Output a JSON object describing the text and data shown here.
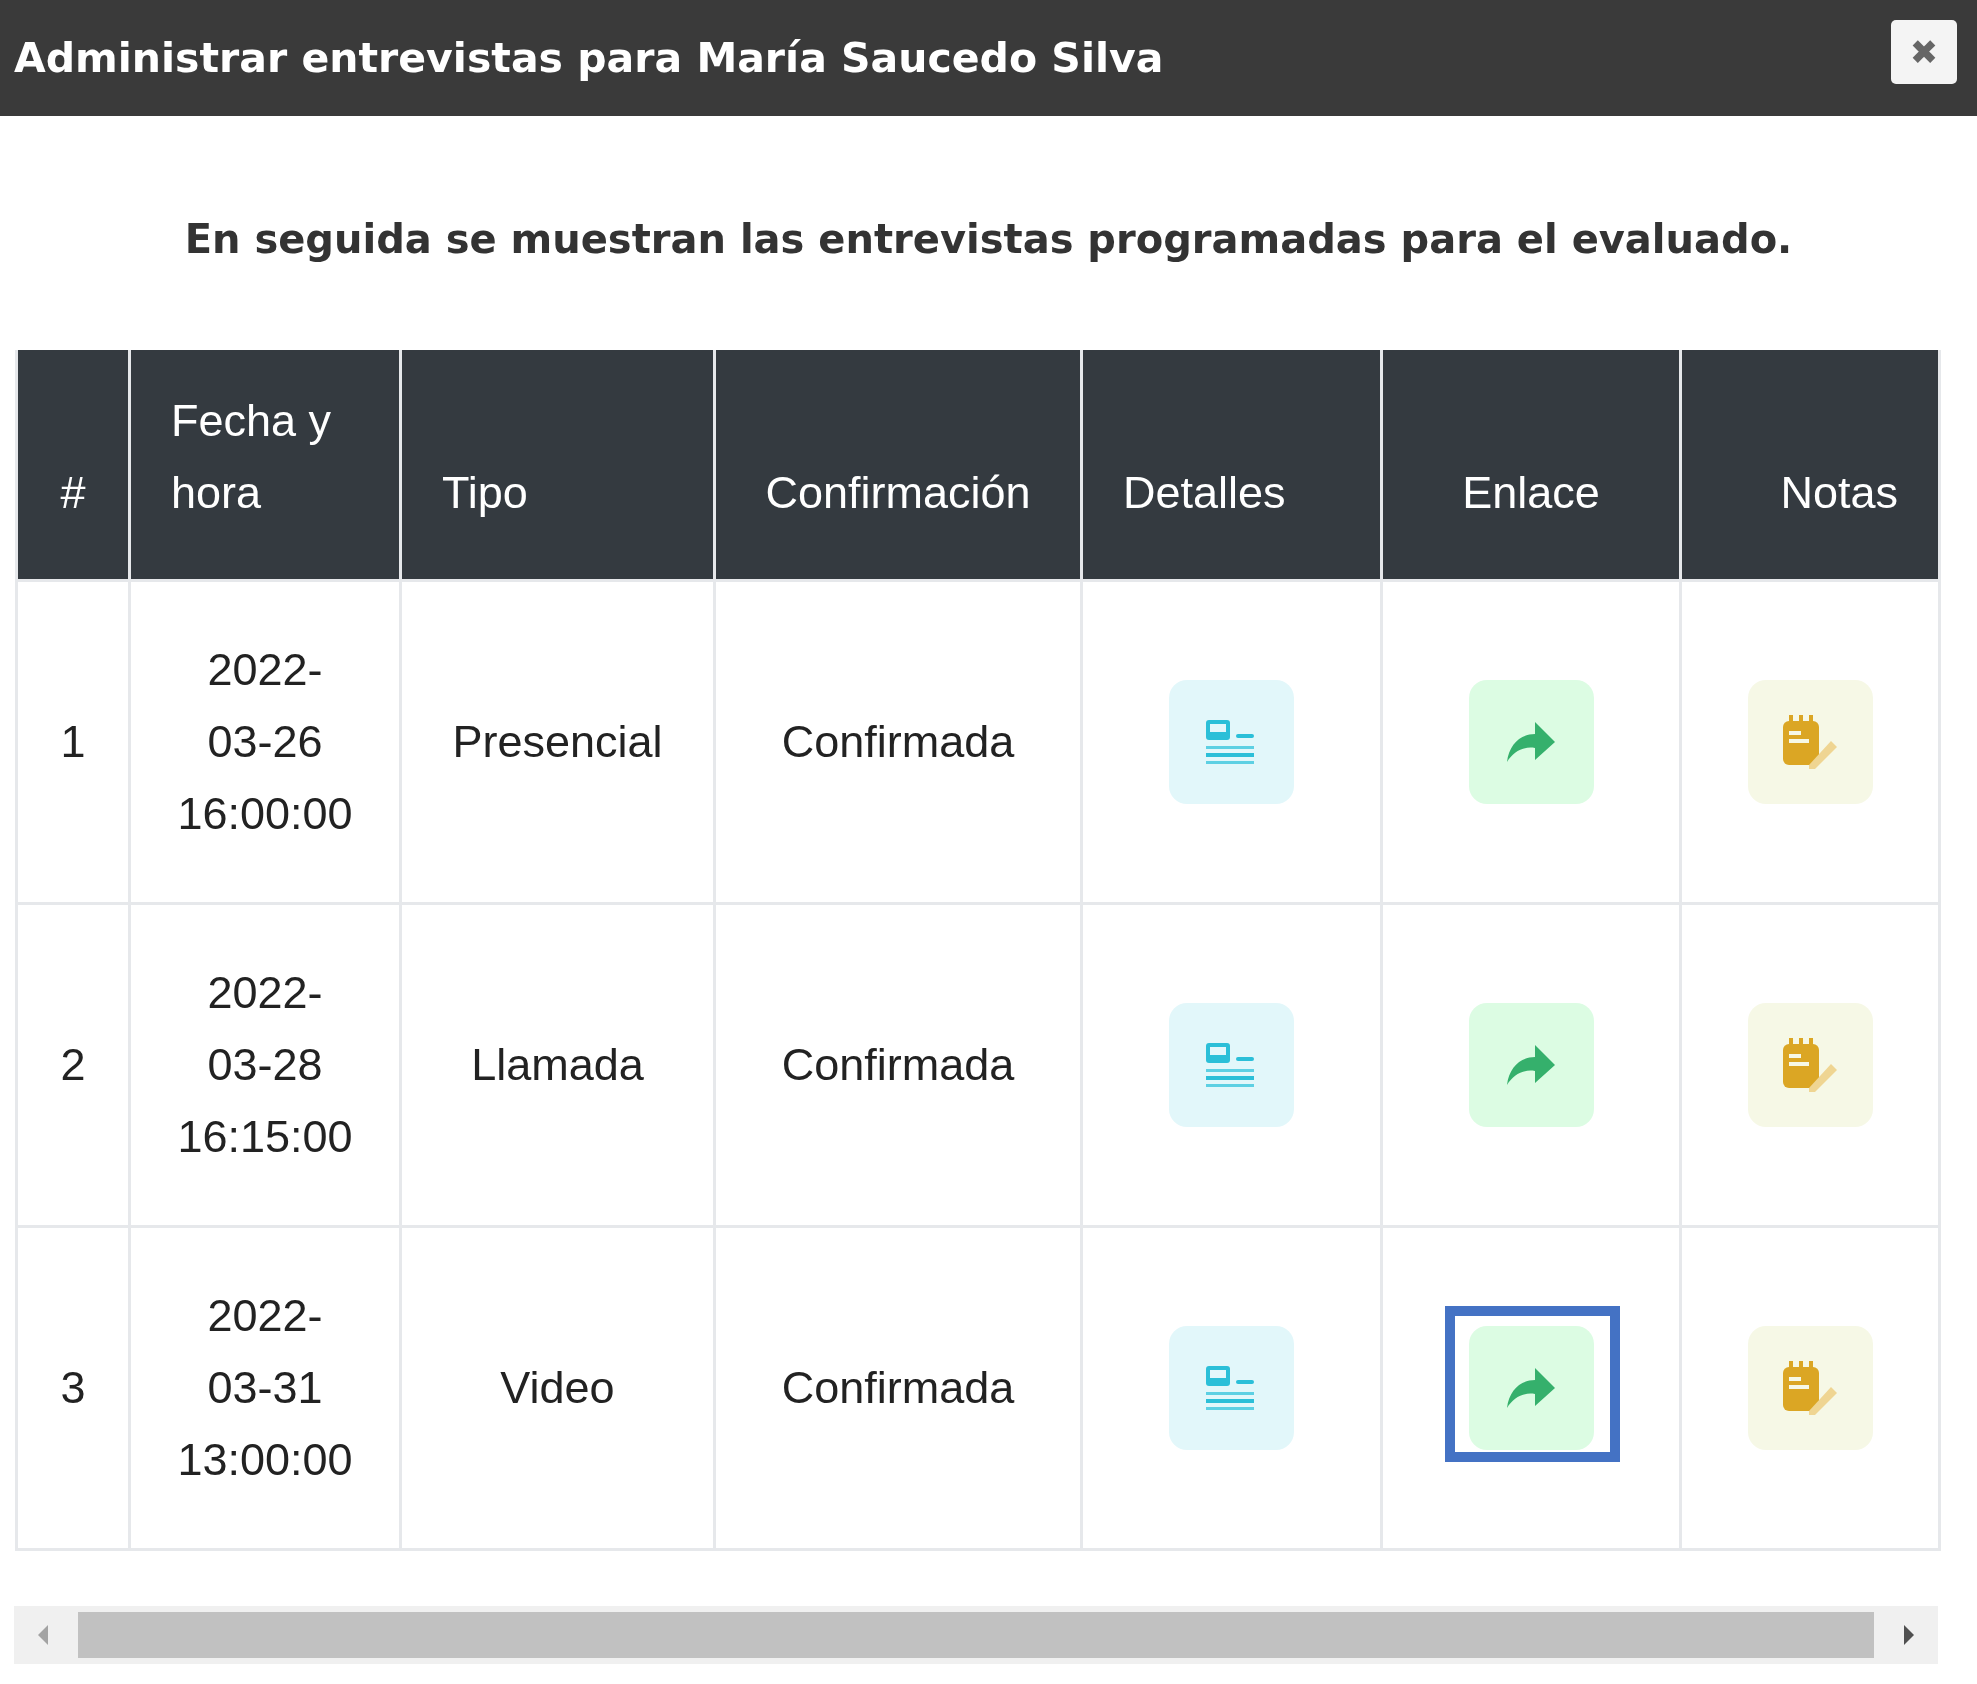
{
  "window": {
    "title": "Administrar entrevistas para María Saucedo Silva",
    "close_label": "✖"
  },
  "intro": "En seguida se muestran las entrevistas programadas para el evaluado.",
  "table": {
    "columns": [
      {
        "label": "#"
      },
      {
        "label": "Fecha y hora"
      },
      {
        "label": "Tipo"
      },
      {
        "label": "Confirmación"
      },
      {
        "label": "Detalles"
      },
      {
        "label": "Enlace"
      },
      {
        "label": "Notas"
      }
    ],
    "rows": [
      {
        "number": "1",
        "datetime": "2022-\n03-26\n16:00:00",
        "type": "Presencial",
        "confirmation": "Confirmada",
        "link_highlighted": false
      },
      {
        "number": "2",
        "datetime": "2022-\n03-28\n16:15:00",
        "type": "Llamada",
        "confirmation": "Confirmada",
        "link_highlighted": false
      },
      {
        "number": "3",
        "datetime": "2022-\n03-31\n13:00:00",
        "type": "Video",
        "confirmation": "Confirmada",
        "link_highlighted": true
      }
    ]
  }
}
